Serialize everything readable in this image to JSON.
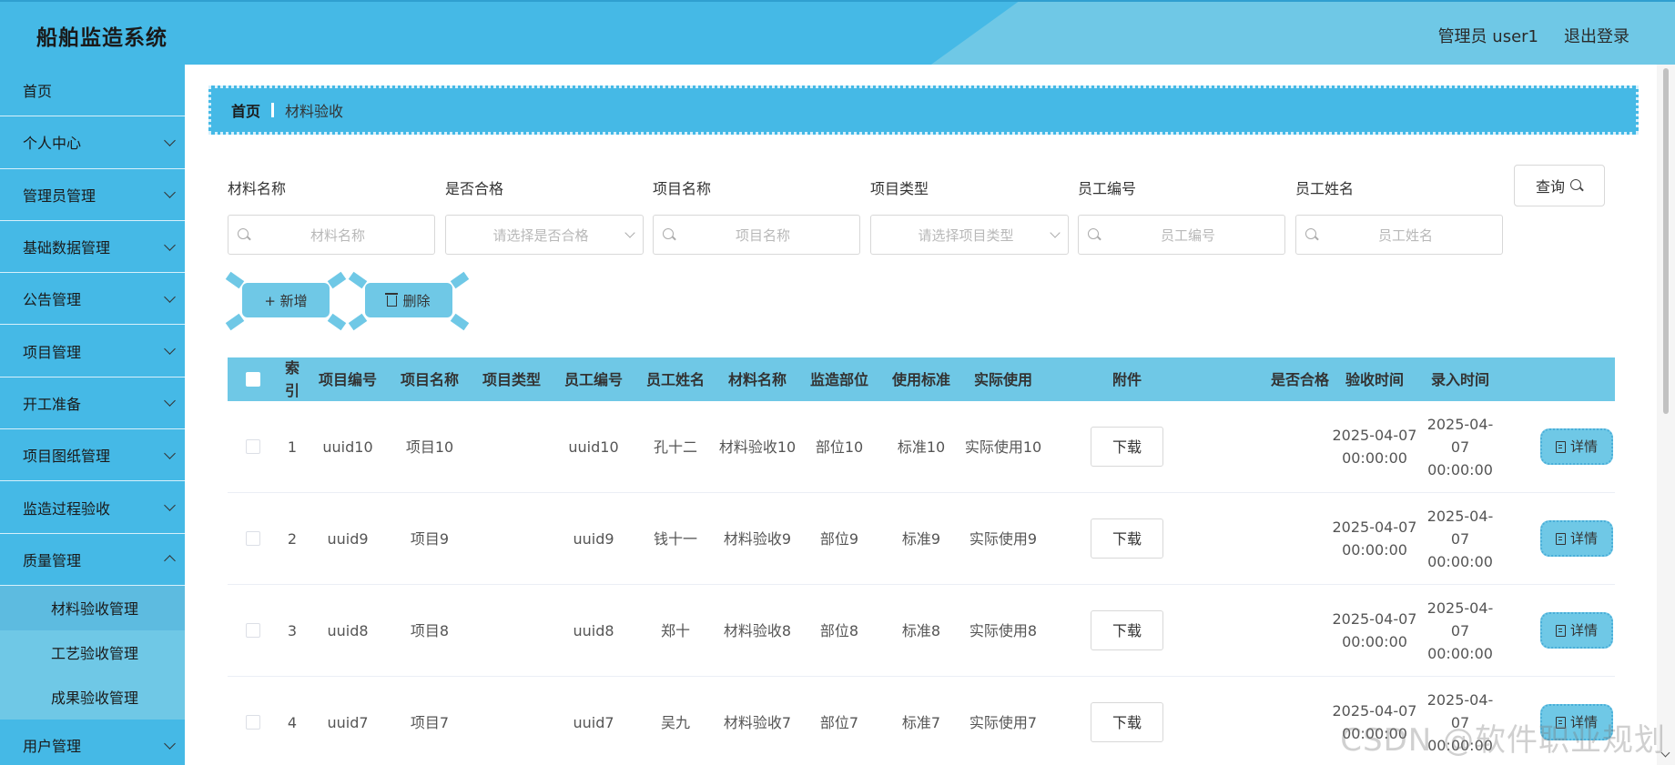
{
  "header": {
    "title": "船舶监造系统",
    "user": "管理员 user1",
    "logout": "退出登录"
  },
  "sidebar": {
    "items": [
      {
        "label": "首页"
      },
      {
        "label": "个人中心"
      },
      {
        "label": "管理员管理"
      },
      {
        "label": "基础数据管理"
      },
      {
        "label": "公告管理"
      },
      {
        "label": "项目管理"
      },
      {
        "label": "开工准备"
      },
      {
        "label": "项目图纸管理"
      },
      {
        "label": "监造过程验收"
      },
      {
        "label": "质量管理"
      }
    ],
    "subitems": [
      {
        "label": "材料验收管理"
      },
      {
        "label": "工艺验收管理"
      },
      {
        "label": "成果验收管理"
      }
    ],
    "last": {
      "label": "用户管理"
    }
  },
  "breadcrumb": {
    "home": "首页",
    "current": "材料验收"
  },
  "filters": [
    {
      "label": "材料名称",
      "placeholder": "材料名称",
      "kind": "search"
    },
    {
      "label": "是否合格",
      "placeholder": "请选择是否合格",
      "kind": "select"
    },
    {
      "label": "项目名称",
      "placeholder": "项目名称",
      "kind": "search"
    },
    {
      "label": "项目类型",
      "placeholder": "请选择项目类型",
      "kind": "select"
    },
    {
      "label": "员工编号",
      "placeholder": "员工编号",
      "kind": "search"
    },
    {
      "label": "员工姓名",
      "placeholder": "员工姓名",
      "kind": "search"
    }
  ],
  "query_label": "查询",
  "actions": {
    "add": "+ 新增",
    "delete": "删除"
  },
  "table": {
    "columns": [
      "索引",
      "项目编号",
      "项目名称",
      "项目类型",
      "员工编号",
      "员工姓名",
      "材料名称",
      "监造部位",
      "使用标准",
      "实际使用",
      "附件",
      "是否合格",
      "验收时间",
      "录入时间"
    ],
    "download_label": "下载",
    "detail_label": "详情",
    "rows": [
      {
        "index": "1",
        "project_no": "uuid10",
        "project_name": "项目10",
        "project_type": "",
        "emp_no": "uuid10",
        "emp_name": "孔十二",
        "material": "材料验收10",
        "dept": "部位10",
        "standard": "标准10",
        "actual": "实际使用10",
        "ok": "",
        "accept_time": "2025-04-07 00:00:00",
        "entry_time": "2025-04-07 00:00:00"
      },
      {
        "index": "2",
        "project_no": "uuid9",
        "project_name": "项目9",
        "project_type": "",
        "emp_no": "uuid9",
        "emp_name": "钱十一",
        "material": "材料验收9",
        "dept": "部位9",
        "standard": "标准9",
        "actual": "实际使用9",
        "ok": "",
        "accept_time": "2025-04-07 00:00:00",
        "entry_time": "2025-04-07 00:00:00"
      },
      {
        "index": "3",
        "project_no": "uuid8",
        "project_name": "项目8",
        "project_type": "",
        "emp_no": "uuid8",
        "emp_name": "郑十",
        "material": "材料验收8",
        "dept": "部位8",
        "standard": "标准8",
        "actual": "实际使用8",
        "ok": "",
        "accept_time": "2025-04-07 00:00:00",
        "entry_time": "2025-04-07 00:00:00"
      },
      {
        "index": "4",
        "project_no": "uuid7",
        "project_name": "项目7",
        "project_type": "",
        "emp_no": "uuid7",
        "emp_name": "吴九",
        "material": "材料验收7",
        "dept": "部位7",
        "standard": "标准7",
        "actual": "实际使用7",
        "ok": "",
        "accept_time": "2025-04-07 00:00:00",
        "entry_time": "2025-04-07 00:00:00"
      }
    ]
  },
  "watermark": "CSDN @软件职业规划",
  "colors": {
    "primary": "#45b9e6",
    "light": "#6fc8e6"
  }
}
